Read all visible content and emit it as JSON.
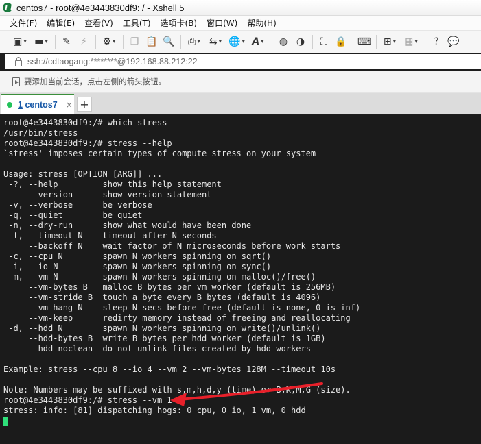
{
  "window": {
    "title": "centos7 - root@4e3443830df9: / - Xshell 5"
  },
  "menubar": {
    "items": [
      "文件(F)",
      "编辑(E)",
      "查看(V)",
      "工具(T)",
      "选项卡(B)",
      "窗口(W)",
      "帮助(H)"
    ]
  },
  "toolbar": {
    "icons": [
      "new-session-icon",
      "open-folder-icon",
      "reconnect-icon",
      "disconnect-icon",
      "properties-icon",
      "copy-icon",
      "paste-icon",
      "find-icon",
      "print-icon",
      "transfer-icon",
      "globe-icon",
      "font-icon",
      "xftp-icon",
      "xmanager-icon",
      "fullscreen-icon",
      "lock-icon",
      "keyboard-icon",
      "add-icon",
      "layout-icon",
      "help-icon",
      "chat-icon"
    ]
  },
  "address": {
    "text": "ssh://cdtaogang:********@192.168.88.212:22"
  },
  "hint": {
    "text": "要添加当前会话，点击左侧的箭头按钮。"
  },
  "tabs": [
    {
      "number": "1",
      "label": "centos7",
      "close": "×"
    }
  ],
  "tab_add_label": "+",
  "terminal": {
    "lines": [
      "root@4e3443830df9:/# which stress",
      "/usr/bin/stress",
      "root@4e3443830df9:/# stress --help",
      "`stress' imposes certain types of compute stress on your system",
      "",
      "Usage: stress [OPTION [ARG]] ...",
      " -?, --help         show this help statement",
      "     --version      show version statement",
      " -v, --verbose      be verbose",
      " -q, --quiet        be quiet",
      " -n, --dry-run      show what would have been done",
      " -t, --timeout N    timeout after N seconds",
      "     --backoff N    wait factor of N microseconds before work starts",
      " -c, --cpu N        spawn N workers spinning on sqrt()",
      " -i, --io N         spawn N workers spinning on sync()",
      " -m, --vm N         spawn N workers spinning on malloc()/free()",
      "     --vm-bytes B   malloc B bytes per vm worker (default is 256MB)",
      "     --vm-stride B  touch a byte every B bytes (default is 4096)",
      "     --vm-hang N    sleep N secs before free (default is none, 0 is inf)",
      "     --vm-keep      redirty memory instead of freeing and reallocating",
      " -d, --hdd N        spawn N workers spinning on write()/unlink()",
      "     --hdd-bytes B  write B bytes per hdd worker (default is 1GB)",
      "     --hdd-noclean  do not unlink files created by hdd workers",
      "",
      "Example: stress --cpu 8 --io 4 --vm 2 --vm-bytes 128M --timeout 10s",
      "",
      "Note: Numbers may be suffixed with s,m,h,d,y (time) or B,K,M,G (size).",
      "root@4e3443830df9:/# stress --vm 1",
      "stress: info: [81] dispatching hogs: 0 cpu, 0 io, 1 vm, 0 hdd"
    ]
  },
  "colors": {
    "terminal_bg": "#1b1b1b",
    "terminal_fg": "#e6e6e6",
    "cursor": "#2fe07a",
    "annotation_arrow": "#e8202a",
    "tab_accent": "#3c8f3c"
  }
}
